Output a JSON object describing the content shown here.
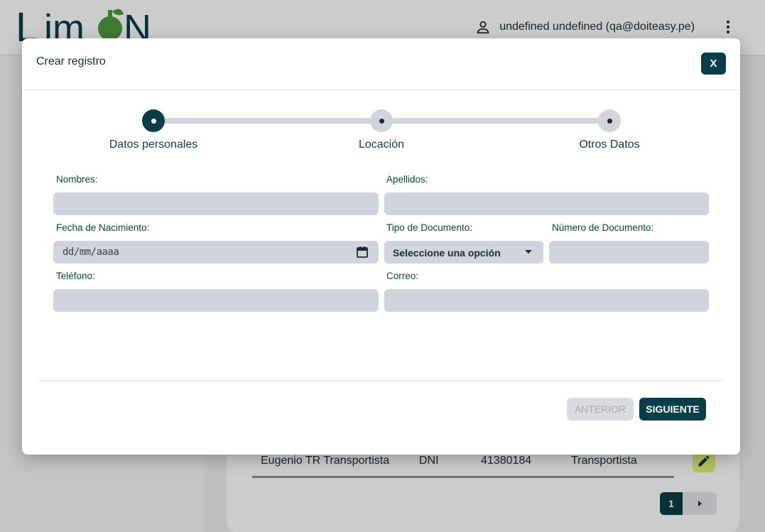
{
  "app": {
    "logo_text": "LimoN",
    "user_label": "undefined undefined (qa@doiteasy.pe)"
  },
  "background_table": {
    "row": {
      "name": "Eugenio TR Transportista",
      "doc_type": "DNI",
      "doc_number": "41380184",
      "role": "Transportista"
    },
    "pager": {
      "current_page": "1"
    }
  },
  "modal": {
    "title": "Crear registro",
    "close_label": "X",
    "steps": [
      {
        "label": "Datos personales",
        "active": true
      },
      {
        "label": "Locación",
        "active": false
      },
      {
        "label": "Otros Datos",
        "active": false
      }
    ],
    "fields": {
      "nombres_label": "Nombres:",
      "apellidos_label": "Apellidos:",
      "fecha_label": "Fecha de Nacimiento:",
      "fecha_placeholder": "dd/mm/aaaa",
      "tipo_doc_label": "Tipo de Documento:",
      "tipo_doc_value": "Seleccione una opción",
      "num_doc_label": "Número de Documento:",
      "telefono_label": "Teléfono:",
      "correo_label": "Correo:"
    },
    "buttons": {
      "prev": "ANTERIOR",
      "next": "SIGUIENTE"
    }
  },
  "colors": {
    "primary": "#063f47",
    "input_bg": "#d1d4dc",
    "accent_yellow": "#e9f07a",
    "logo_green": "#4d9b3a"
  }
}
